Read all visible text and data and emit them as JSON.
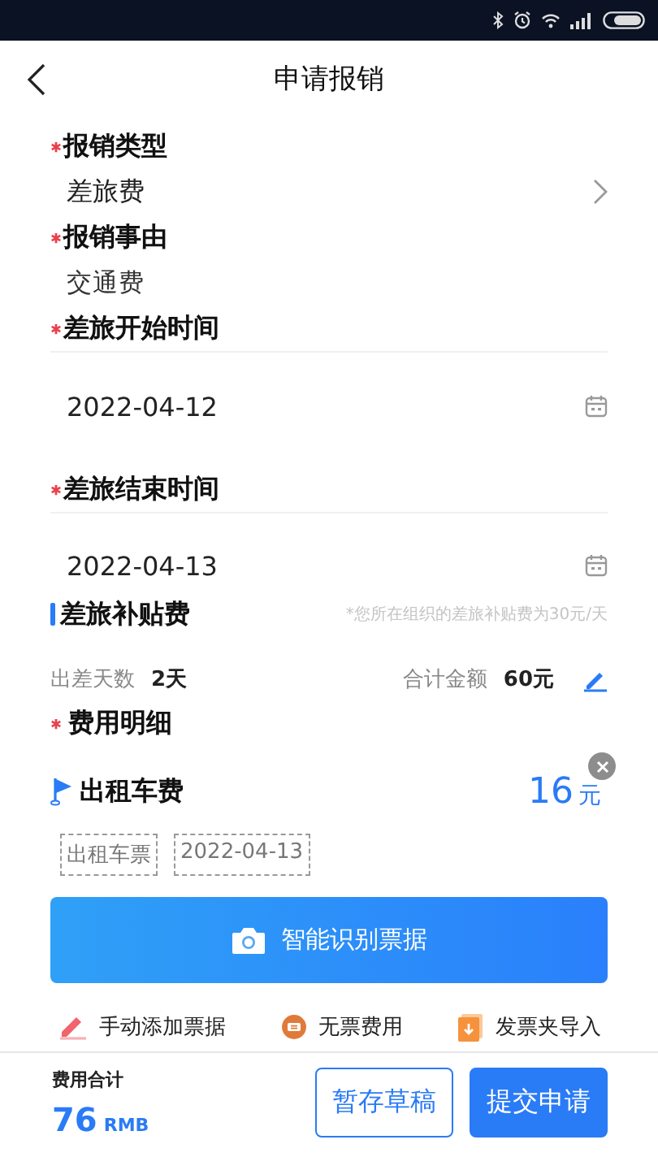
{
  "header": {
    "title": "申请报销"
  },
  "fields": [
    {
      "kind": "select",
      "label": "报销类型",
      "required": true,
      "value": "差旅费"
    },
    {
      "kind": "text",
      "label": "报销事由",
      "required": true,
      "value": "交通费"
    },
    {
      "kind": "date",
      "label": "差旅开始时间",
      "required": true,
      "value": "2022-04-12"
    },
    {
      "kind": "date",
      "label": "差旅结束时间",
      "required": true,
      "value": "2022-04-13"
    }
  ],
  "allowance": {
    "title": "差旅补贴费",
    "note": "*您所在组织的差旅补贴费为30元/天",
    "days_label": "出差天数",
    "days": "2天",
    "total_label": "合计金额",
    "total": "60元"
  },
  "details": {
    "title": "费用明细",
    "required": true,
    "items": [
      {
        "name": "出租车费",
        "amount": "16",
        "unit": "元",
        "tags": [
          "出租车票",
          "2022-04-13"
        ]
      }
    ],
    "scan_button": "智能识别票据",
    "actions": [
      {
        "kind": "manual",
        "label": "手动添加票据"
      },
      {
        "kind": "no_ticket",
        "label": "无票费用"
      },
      {
        "kind": "import",
        "label": "发票夹导入"
      }
    ]
  },
  "footer": {
    "total_label": "费用合计",
    "total": "76",
    "unit": "RMB",
    "buttons": [
      {
        "kind": "secondary",
        "label": "暂存草稿"
      },
      {
        "kind": "primary",
        "label": "提交申请"
      }
    ]
  }
}
